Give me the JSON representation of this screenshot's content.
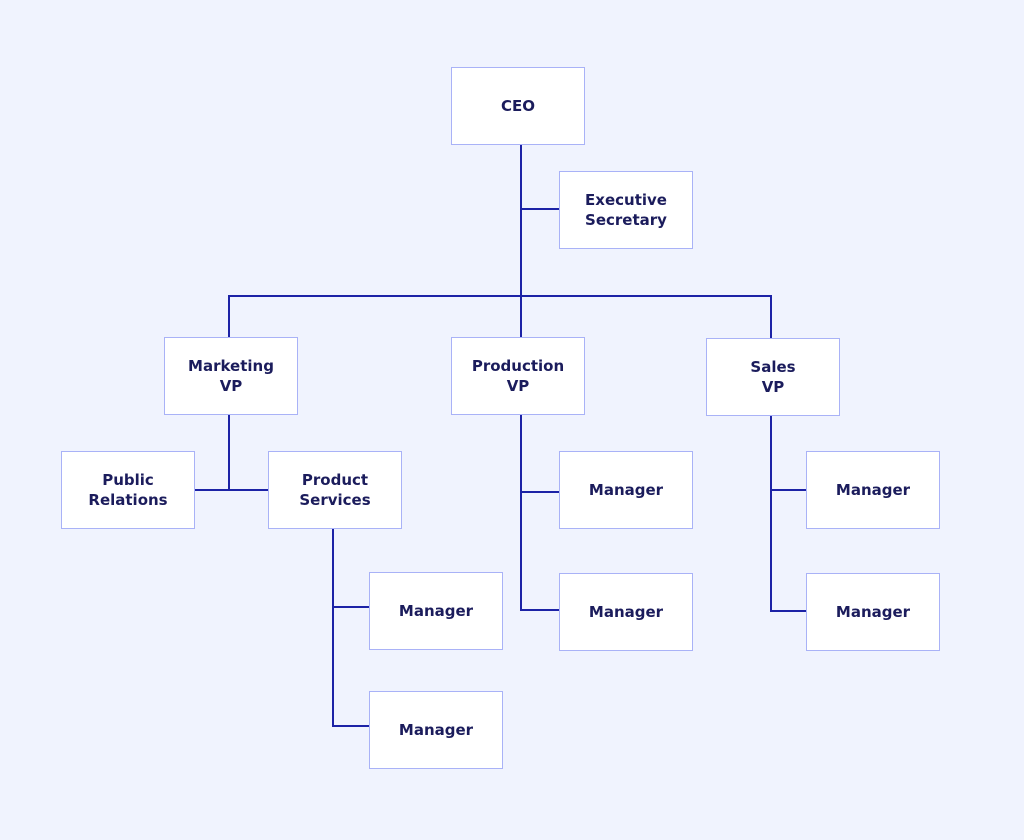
{
  "diagram": {
    "type": "org-chart",
    "colors": {
      "background": "#f0f3fe",
      "connector": "#1c22a6",
      "node_border": "#a9b2f7",
      "node_fill": "#ffffff",
      "text": "#1b1c5c"
    },
    "nodes": {
      "ceo": "CEO",
      "executive_secretary": "Executive\nSecretary",
      "marketing_vp": "Marketing\nVP",
      "production_vp": "Production\nVP",
      "sales_vp": "Sales\nVP",
      "public_relations": "Public\nRelations",
      "product_services": "Product\nServices",
      "product_services_manager_1": "Manager",
      "product_services_manager_2": "Manager",
      "production_manager_1": "Manager",
      "production_manager_2": "Manager",
      "sales_manager_1": "Manager",
      "sales_manager_2": "Manager"
    },
    "edges": [
      [
        "ceo",
        "executive_secretary"
      ],
      [
        "ceo",
        "marketing_vp"
      ],
      [
        "ceo",
        "production_vp"
      ],
      [
        "ceo",
        "sales_vp"
      ],
      [
        "marketing_vp",
        "public_relations"
      ],
      [
        "marketing_vp",
        "product_services"
      ],
      [
        "product_services",
        "product_services_manager_1"
      ],
      [
        "product_services",
        "product_services_manager_2"
      ],
      [
        "production_vp",
        "production_manager_1"
      ],
      [
        "production_vp",
        "production_manager_2"
      ],
      [
        "sales_vp",
        "sales_manager_1"
      ],
      [
        "sales_vp",
        "sales_manager_2"
      ]
    ]
  }
}
